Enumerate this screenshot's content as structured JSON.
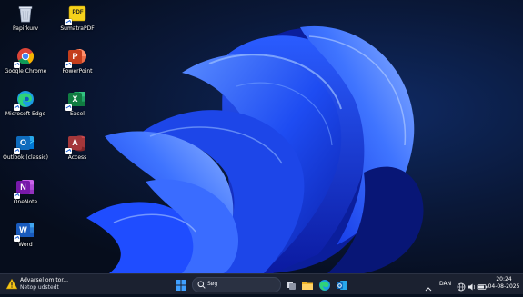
{
  "desktop_icons": [
    {
      "id": "recycle-bin",
      "label": "Papirkurv",
      "icon": "recycle-bin-icon"
    },
    {
      "id": "sumatrapdf",
      "label": "SumatraPDF",
      "icon": "sumatrapdf-icon",
      "glyph": "PDF"
    },
    {
      "id": "chrome",
      "label": "Google Chrome",
      "icon": "chrome-icon"
    },
    {
      "id": "powerpoint",
      "label": "PowerPoint",
      "icon": "powerpoint-icon",
      "glyph": "P"
    },
    {
      "id": "edge",
      "label": "Microsoft Edge",
      "icon": "edge-icon"
    },
    {
      "id": "excel",
      "label": "Excel",
      "icon": "excel-icon",
      "glyph": "X"
    },
    {
      "id": "outlook",
      "label": "Outlook (classic)",
      "icon": "outlook-icon",
      "glyph": "O"
    },
    {
      "id": "access",
      "label": "Access",
      "icon": "access-icon",
      "glyph": "A"
    },
    {
      "id": "onenote",
      "label": "OneNote",
      "icon": "onenote-icon",
      "glyph": "N"
    },
    {
      "id": "word",
      "label": "Word",
      "icon": "word-icon",
      "glyph": "W"
    }
  ],
  "taskbar": {
    "weather": {
      "title": "Advarsel om tor...",
      "subtitle": "Netop udstedt",
      "icon": "warning-icon"
    },
    "search": {
      "placeholder": "Søg"
    },
    "pinned": [
      "task-view-icon",
      "file-explorer-icon",
      "edge-icon",
      "outlook-icon"
    ],
    "tray": {
      "language": "DAN",
      "chevron": "chevron-up-icon"
    },
    "clock": {
      "time": "20:24",
      "date": "04-08-2025"
    }
  },
  "colors": {
    "taskbar": "#1b2130",
    "wallpaper_blue": "#1f55ff",
    "powerpoint": "#c43e1c",
    "excel": "#107c41",
    "outlook": "#0f6cbd",
    "access": "#a4373a",
    "onenote": "#7719aa",
    "word": "#185abd"
  }
}
